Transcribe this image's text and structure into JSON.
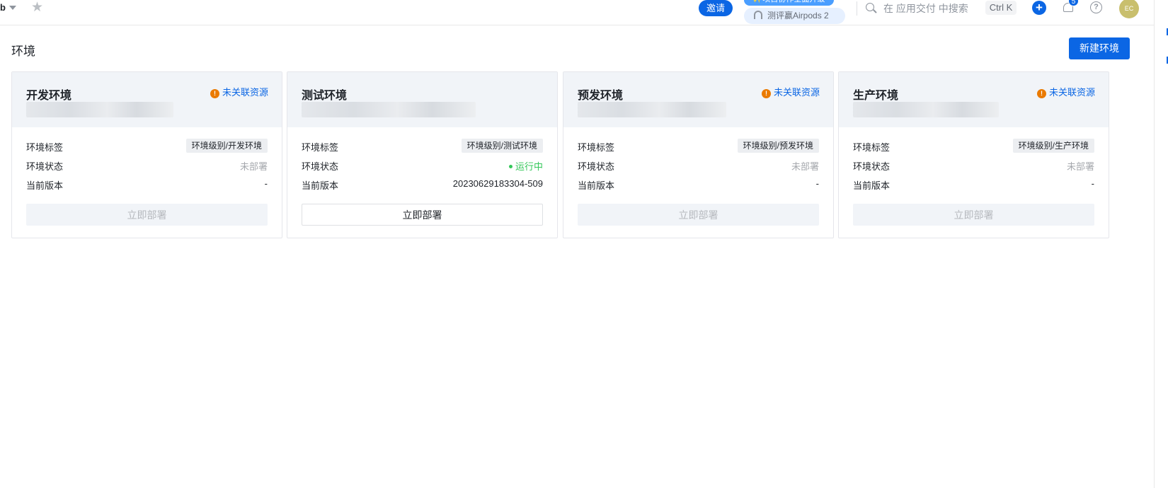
{
  "topbar": {
    "project_name": "b",
    "invite_label": "邀请",
    "promo_top": "✨项目协作全面升级",
    "promo_bottom": "测评赢Airpods 2",
    "search_placeholder": "在 应用交付 中搜索",
    "shortcut": "Ctrl K",
    "notification_count": "5",
    "help_glyph": "?",
    "avatar_initials": "EC"
  },
  "page": {
    "title": "环境",
    "new_env_button": "新建环境"
  },
  "labels": {
    "tag": "环境标签",
    "status": "环境状态",
    "version": "当前版本",
    "deploy": "立即部署",
    "warn_icon": "!"
  },
  "cards": [
    {
      "title": "开发环境",
      "warning": "未关联资源",
      "tag": "环境级别/开发环境",
      "status": "未部署",
      "version": "-",
      "deploy_enabled": false
    },
    {
      "title": "测试环境",
      "warning": "",
      "tag": "环境级别/测试环境",
      "status": "运行中",
      "version": "20230629183304-509",
      "deploy_enabled": true
    },
    {
      "title": "预发环境",
      "warning": "未关联资源",
      "tag": "环境级别/预发环境",
      "status": "未部署",
      "version": "-",
      "deploy_enabled": false
    },
    {
      "title": "生产环境",
      "warning": "未关联资源",
      "tag": "环境级别/生产环境",
      "status": "未部署",
      "version": "-",
      "deploy_enabled": false
    }
  ],
  "colors": {
    "primary": "#0b66e4",
    "warning": "#ea7a00",
    "running": "#34c759",
    "card_header": "#f1f4f8"
  }
}
